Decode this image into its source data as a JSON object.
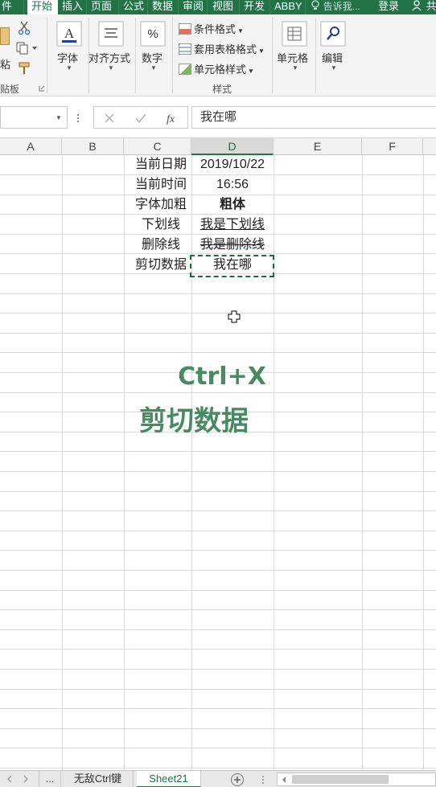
{
  "ribbon": {
    "tabs": [
      "件",
      "开始",
      "插入",
      "页面",
      "公式",
      "数据",
      "审阅",
      "视图",
      "开发",
      "ABBY",
      "告诉我...",
      "登录",
      "共"
    ],
    "groups": {
      "clipboard_label": "贴板",
      "clipboard_paste": "粘",
      "font_label": "字体",
      "align_label": "对齐方式",
      "number_label": "数字",
      "styles_items": [
        "条件格式",
        "套用表格格式",
        "单元格样式"
      ],
      "styles_label": "样式",
      "cells_label": "单元格",
      "edit_label": "编辑"
    }
  },
  "formula_bar": {
    "value": "我在哪"
  },
  "columns": [
    "A",
    "B",
    "C",
    "D",
    "E",
    "F"
  ],
  "cells": {
    "c1": "当前日期",
    "d1": "2019/10/22",
    "c2": "当前时间",
    "d2": "16:56",
    "c3": "字体加粗",
    "d3": "粗体",
    "c4": "下划线",
    "d4": "我是下划线",
    "c5": "删除线",
    "d5": "我是删除线",
    "c6": "剪切数据",
    "d6": "我在哪"
  },
  "overlay": {
    "line1": "Ctrl+X",
    "line2": "剪切数据"
  },
  "sheet_tabs": [
    "...",
    "无敌Ctrl键",
    "Sheet21"
  ],
  "colors": {
    "accent": "#217346",
    "overlay": "#4a8a63"
  },
  "icons": [
    "scissors-icon",
    "copy-icon",
    "format-painter-icon",
    "font-icon",
    "align-icon",
    "percent-icon",
    "conditional-format-icon",
    "table-format-icon",
    "cell-style-icon",
    "cells-icon",
    "search-icon",
    "lightbulb-icon",
    "person-icon",
    "cancel-icon",
    "enter-icon",
    "fx-icon",
    "add-sheet-icon",
    "cursor-move-icon"
  ]
}
